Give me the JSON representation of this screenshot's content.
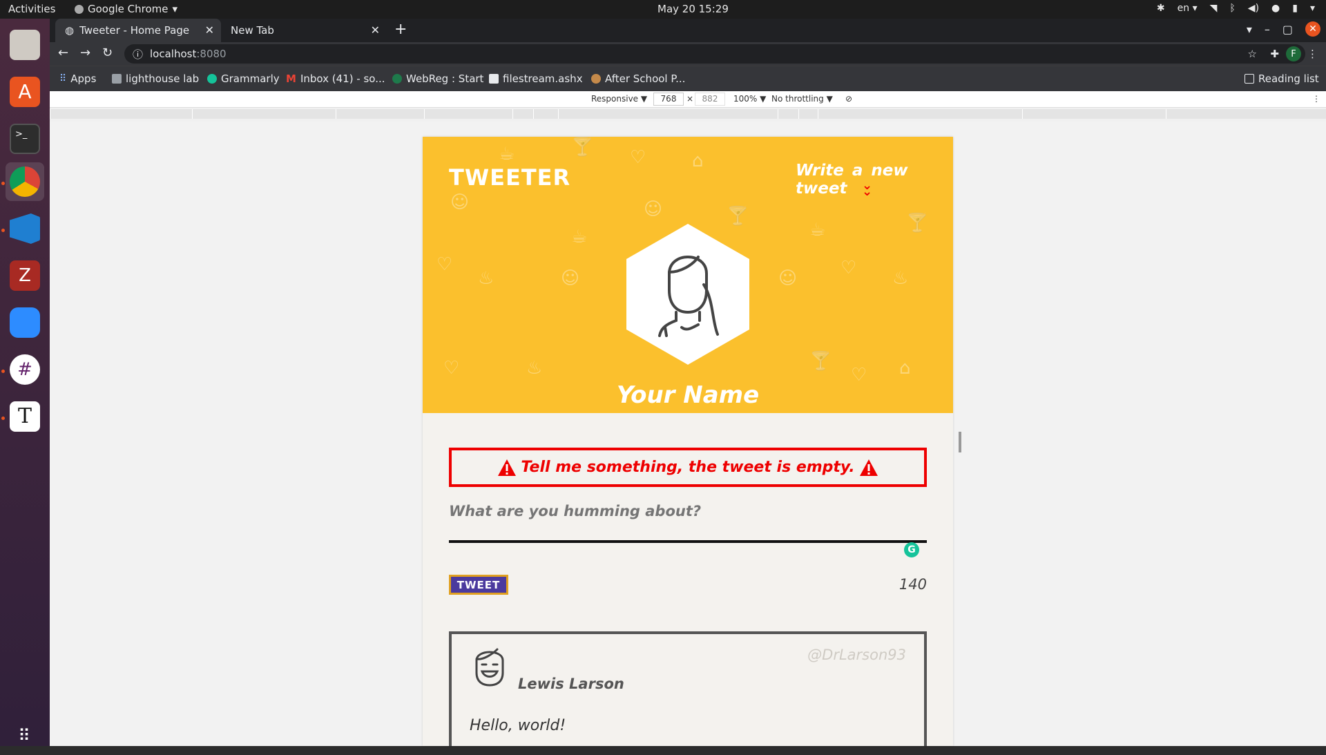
{
  "os": {
    "activities": "Activities",
    "app_name": "Google Chrome",
    "clock": "May 20  15:29",
    "lang": "en"
  },
  "browser": {
    "tabs": [
      {
        "label": "Tweeter - Home Page"
      },
      {
        "label": "New Tab"
      }
    ],
    "url_host": "localhost",
    "url_port": ":8080",
    "profile_initial": "F",
    "bookmarks": [
      {
        "label": "Apps"
      },
      {
        "label": "lighthouse lab"
      },
      {
        "label": "Grammarly"
      },
      {
        "label": "Inbox (41) - so..."
      },
      {
        "label": "WebReg : Start"
      },
      {
        "label": "filestream.ashx"
      },
      {
        "label": "After School P..."
      }
    ],
    "reading_list": "Reading list"
  },
  "devtools": {
    "device": "Responsive ▼",
    "width": "768",
    "height": "882",
    "zoom": "100% ▼",
    "throttle": "No throttling ▼",
    "times": "×"
  },
  "tweeter": {
    "brand": "TWEETER",
    "write_new": "Write a  new  tweet",
    "user_name": "Your Name",
    "error_message": "Tell me something, the tweet is empty.",
    "compose_placeholder": "What are you humming about?",
    "tweet_button": "TWEET",
    "char_counter": "140",
    "accent_color": "#fbc02d",
    "error_color": "#e00000",
    "button_color": "#4b3a9e",
    "tweets": [
      {
        "handle": "@DrLarson93",
        "author": "Lewis Larson",
        "text": "Hello, world!"
      }
    ]
  }
}
